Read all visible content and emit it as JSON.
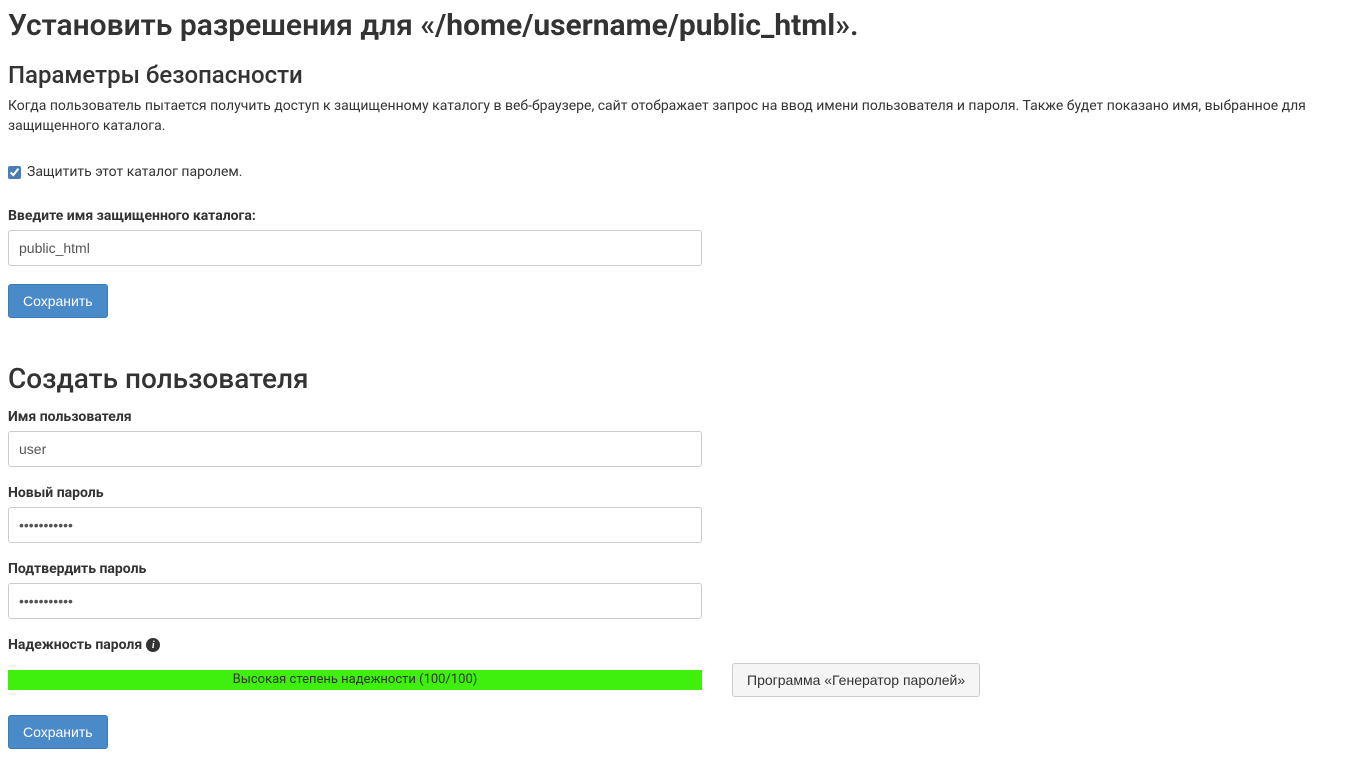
{
  "heading": {
    "prefix": "Установить разрешения для «",
    "path": "/home/username/public_html",
    "suffix": "»."
  },
  "security": {
    "title": "Параметры безопасности",
    "description": "Когда пользователь пытается получить доступ к защищенному каталогу в веб-браузере, сайт отображает запрос на ввод имени пользователя и пароля. Также будет показано имя, выбранное для защищенного каталога.",
    "protect_label": "Защитить этот каталог паролем.",
    "protect_checked": true,
    "dirname_label": "Введите имя защищенного каталога:",
    "dirname_value": "public_html",
    "save_label": "Сохранить"
  },
  "create_user": {
    "title": "Создать пользователя",
    "username_label": "Имя пользователя",
    "username_value": "user",
    "newpass_label": "Новый пароль",
    "newpass_value": "•••••••••••",
    "confirmpass_label": "Подтвердить пароль",
    "confirmpass_value": "•••••••••••",
    "strength_label": "Надежность пароля",
    "strength_text": "Высокая степень надежности (100/100)",
    "generator_label": "Программа «Генератор паролей»",
    "save_label": "Сохранить"
  }
}
